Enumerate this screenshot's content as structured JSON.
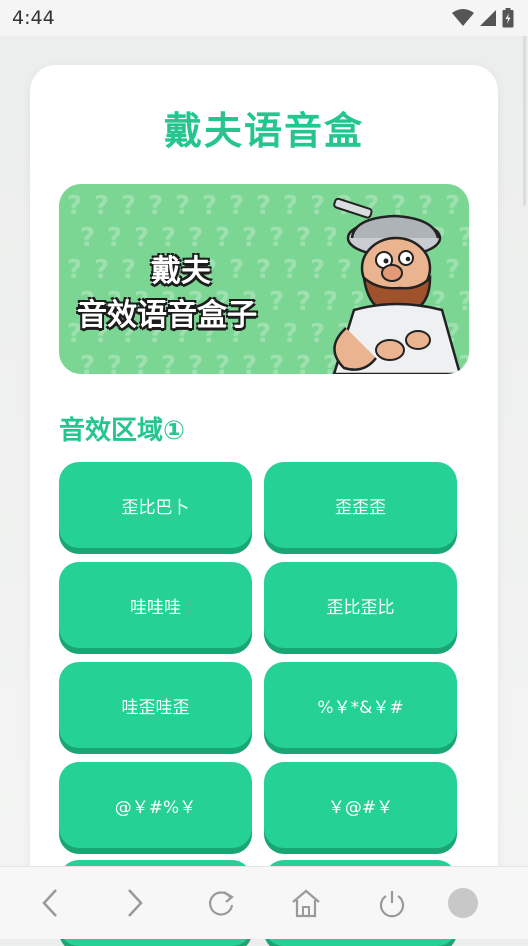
{
  "status_bar": {
    "time": "4:44"
  },
  "app": {
    "title": "戴夫语音盒"
  },
  "banner": {
    "line1": "戴夫",
    "line2": "音效语音盒子",
    "pattern_glyph": "?"
  },
  "section": {
    "title": "音效区域①"
  },
  "buttons": [
    {
      "label": "歪比巴卜"
    },
    {
      "label": "歪歪歪"
    },
    {
      "label": "哇哇哇"
    },
    {
      "label": "歪比歪比"
    },
    {
      "label": "哇歪哇歪"
    },
    {
      "label": "%￥*&￥#"
    },
    {
      "label": "@￥#%￥"
    },
    {
      "label": "￥@#￥"
    }
  ],
  "nav": {
    "items": [
      "back-icon",
      "forward-icon",
      "refresh-icon",
      "home-icon",
      "power-icon",
      "circle-icon"
    ]
  },
  "colors": {
    "accent": "#25c58e",
    "button": "#25d194",
    "button_shadow": "#1aa672",
    "banner": "#7bd694"
  }
}
